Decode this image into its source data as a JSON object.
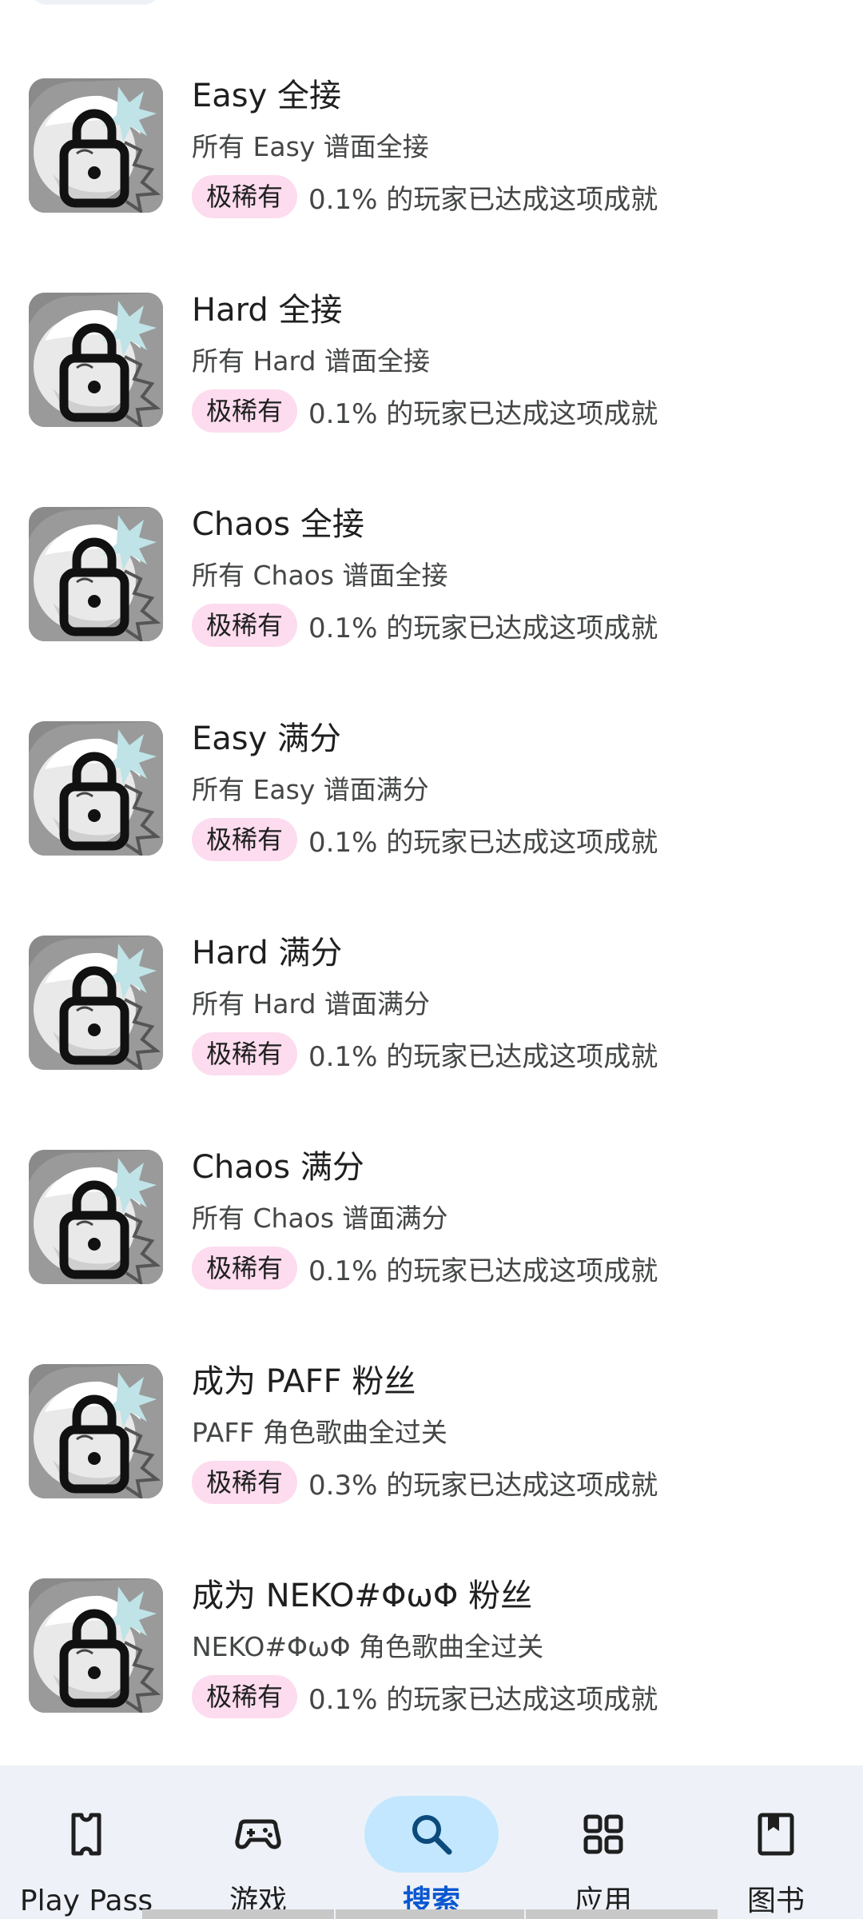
{
  "achievements": [
    {
      "title": "Easy 全接",
      "description": "所有 Easy 谱面全接",
      "rarity": "极稀有",
      "percentage": "0.1% 的玩家已达成这项成就"
    },
    {
      "title": "Hard 全接",
      "description": "所有 Hard 谱面全接",
      "rarity": "极稀有",
      "percentage": "0.1% 的玩家已达成这项成就"
    },
    {
      "title": "Chaos 全接",
      "description": "所有 Chaos 谱面全接",
      "rarity": "极稀有",
      "percentage": "0.1% 的玩家已达成这项成就"
    },
    {
      "title": "Easy 满分",
      "description": "所有 Easy 谱面满分",
      "rarity": "极稀有",
      "percentage": "0.1% 的玩家已达成这项成就"
    },
    {
      "title": "Hard 满分",
      "description": "所有 Hard 谱面满分",
      "rarity": "极稀有",
      "percentage": "0.1% 的玩家已达成这项成就"
    },
    {
      "title": "Chaos 满分",
      "description": "所有 Chaos 谱面满分",
      "rarity": "极稀有",
      "percentage": "0.1% 的玩家已达成这项成就"
    },
    {
      "title": "成为 PAFF 粉丝",
      "description": "PAFF 角色歌曲全过关",
      "rarity": "极稀有",
      "percentage": "0.3% 的玩家已达成这项成就"
    },
    {
      "title": "成为 NEKO#ΦωΦ 粉丝",
      "description": "NEKO#ΦωΦ 角色歌曲全过关",
      "rarity": "极稀有",
      "percentage": "0.1% 的玩家已达成这项成就"
    }
  ],
  "achievement_icon": "lock-icon",
  "nav": {
    "items": [
      {
        "label": "Play Pass",
        "icon": "play-pass-icon",
        "active": false
      },
      {
        "label": "游戏",
        "icon": "gamepad-icon",
        "active": false
      },
      {
        "label": "搜索",
        "icon": "search-icon",
        "active": true
      },
      {
        "label": "应用",
        "icon": "apps-grid-icon",
        "active": false
      },
      {
        "label": "图书",
        "icon": "bookmark-book-icon",
        "active": false
      }
    ]
  },
  "colors": {
    "rarity_badge_bg": "#fcdcee",
    "active_nav_pill": "#c2e7ff",
    "active_nav_text": "#0b57d0",
    "nav_background": "#eef2f8"
  }
}
